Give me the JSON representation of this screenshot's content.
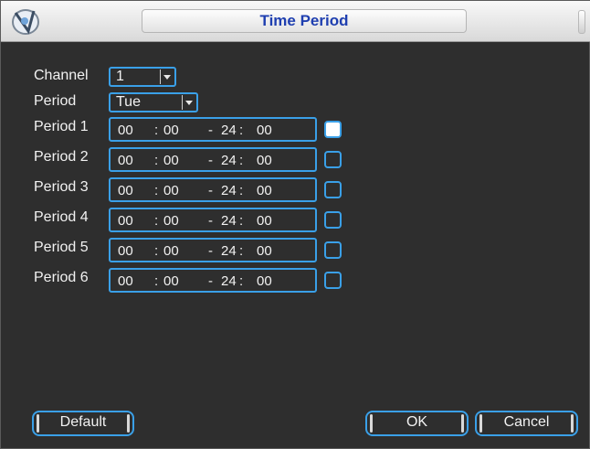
{
  "window": {
    "title": "Time Period"
  },
  "channel": {
    "label": "Channel",
    "value": "1"
  },
  "period_select": {
    "label": "Period",
    "value": "Tue"
  },
  "periods": [
    {
      "label": "Period 1",
      "start_h": "00",
      "start_m": "00",
      "end_h": "24",
      "end_m": "00",
      "checked": true
    },
    {
      "label": "Period 2",
      "start_h": "00",
      "start_m": "00",
      "end_h": "24",
      "end_m": "00",
      "checked": false
    },
    {
      "label": "Period 3",
      "start_h": "00",
      "start_m": "00",
      "end_h": "24",
      "end_m": "00",
      "checked": false
    },
    {
      "label": "Period 4",
      "start_h": "00",
      "start_m": "00",
      "end_h": "24",
      "end_m": "00",
      "checked": false
    },
    {
      "label": "Period 5",
      "start_h": "00",
      "start_m": "00",
      "end_h": "24",
      "end_m": "00",
      "checked": false
    },
    {
      "label": "Period 6",
      "start_h": "00",
      "start_m": "00",
      "end_h": "24",
      "end_m": "00",
      "checked": false
    }
  ],
  "buttons": {
    "default": "Default",
    "ok": "OK",
    "cancel": "Cancel"
  },
  "colors": {
    "accent": "#3aa0e8",
    "background": "#2e2e2e",
    "title_text": "#1f3fb0"
  }
}
